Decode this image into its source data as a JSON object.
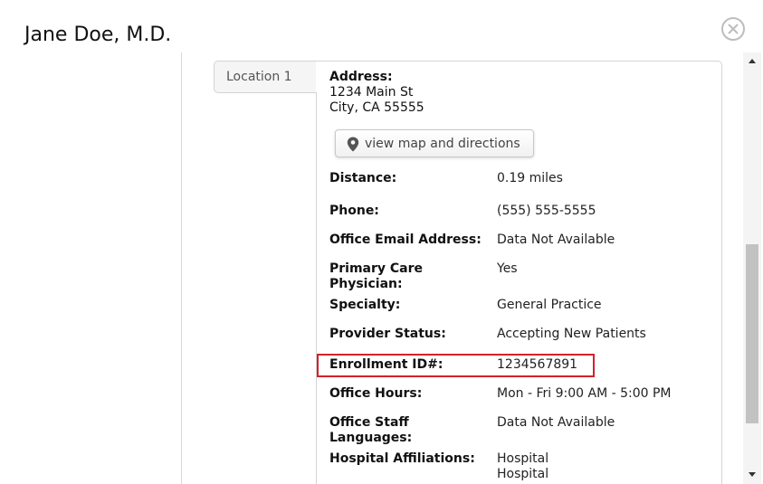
{
  "modal": {
    "title": "Jane Doe, M.D."
  },
  "location_tab": {
    "label": "Location 1"
  },
  "address": {
    "label": "Address:",
    "line1": "1234 Main St",
    "line2": "City, CA 55555"
  },
  "map_button": {
    "label": "view map and directions",
    "icon": "map-pin-icon"
  },
  "details": [
    {
      "label": "Distance:",
      "value": "0.19 miles"
    },
    {
      "label": "Phone:",
      "value": "(555) 555-5555"
    },
    {
      "label": "Office Email Address:",
      "value": "Data Not Available"
    },
    {
      "label": "Primary Care Physician:",
      "value": "Yes"
    },
    {
      "label": "Specialty:",
      "value": "General Practice"
    },
    {
      "label": "Provider Status:",
      "value": "Accepting New Patients"
    },
    {
      "label": "Enrollment ID#:",
      "value": "1234567891"
    },
    {
      "label": "Office Hours:",
      "value": "Mon - Fri 9:00 AM - 5:00 PM"
    },
    {
      "label": "Office Staff Languages:",
      "value": "Data Not Available"
    },
    {
      "label": "Hospital Affiliations:",
      "value": "Hospital"
    }
  ],
  "hospital_affiliation_extra": "Hospital",
  "colors": {
    "highlight": "#d0232a",
    "border": "#d4d4d4",
    "scroll_thumb": "#c2c2c2"
  }
}
